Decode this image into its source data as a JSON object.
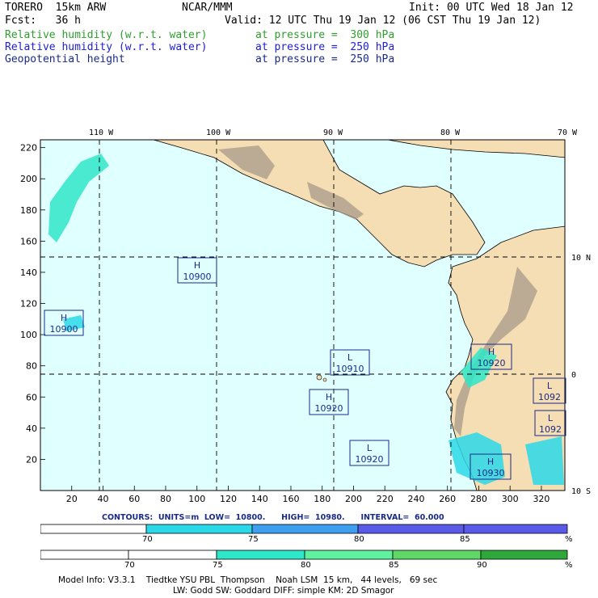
{
  "header": {
    "model": "TORERO  15km ARW",
    "center": "NCAR/MMM",
    "init": "Init: 00 UTC Wed 18 Jan 12",
    "fcst": "Fcst:   36 h",
    "valid": "Valid: 12 UTC Thu 19 Jan 12 (06 CST Thu 19 Jan 12)",
    "fields": [
      {
        "name": "Relative humidity (w.r.t. water)",
        "level": "at pressure =  300 hPa",
        "color": "#2f9e2f"
      },
      {
        "name": "Relative humidity (w.r.t. water)",
        "level": "at pressure =  250 hPa",
        "color": "#2020d0"
      },
      {
        "name": "Geopotential height",
        "level": "at pressure =  250 hPa",
        "color": "#1a2a8a"
      }
    ]
  },
  "map": {
    "lon_labels": [
      "110 W",
      "100 W",
      "90 W",
      "80 W",
      "70 W"
    ],
    "lat_labels": [
      "10 N",
      "0",
      "10 S"
    ],
    "x_ticks": [
      "20",
      "40",
      "60",
      "80",
      "100",
      "120",
      "140",
      "160",
      "180",
      "200",
      "220",
      "240",
      "260",
      "280",
      "300",
      "320"
    ],
    "y_ticks": [
      "20",
      "40",
      "60",
      "80",
      "100",
      "120",
      "140",
      "160",
      "180",
      "200",
      "220"
    ],
    "pressure_centers": [
      {
        "type": "H",
        "value": "10900"
      },
      {
        "type": "H",
        "value": "10900"
      },
      {
        "type": "L",
        "value": "10910"
      },
      {
        "type": "H",
        "value": "10920"
      },
      {
        "type": "H",
        "value": "10920"
      },
      {
        "type": "L",
        "value": "10920"
      },
      {
        "type": "H",
        "value": "10930"
      },
      {
        "type": "L",
        "value": "1092"
      },
      {
        "type": "L",
        "value": "1092"
      }
    ],
    "colors": {
      "ocean": "#e0ffff",
      "land": "#f5deb3",
      "terrain": "#a89a8a"
    }
  },
  "contours": {
    "text": "CONTOURS:  UNITS=m  LOW=  10800.      HIGH=  10980.      INTERVAL=  60.000"
  },
  "colorbar_250": {
    "labels": [
      "70",
      "75",
      "80",
      "85",
      "%"
    ],
    "colors": [
      "#ffffff",
      "#2ad8e8",
      "#3e9ef0",
      "#5a5ae8"
    ]
  },
  "colorbar_300": {
    "labels": [
      "70",
      "75",
      "80",
      "85",
      "90",
      "%"
    ],
    "colors": [
      "#ffffff",
      "#2ee6c8",
      "#5ff0a0",
      "#5fd868",
      "#2ea83a"
    ]
  },
  "model_info": {
    "line1": "Model Info: V3.3.1    Tiedtke YSU PBL  Thompson    Noah LSM  15 km,   44 levels,   69 sec",
    "line2": "LW: Godd SW: Goddard DIFF: simple KM: 2D Smagor"
  }
}
